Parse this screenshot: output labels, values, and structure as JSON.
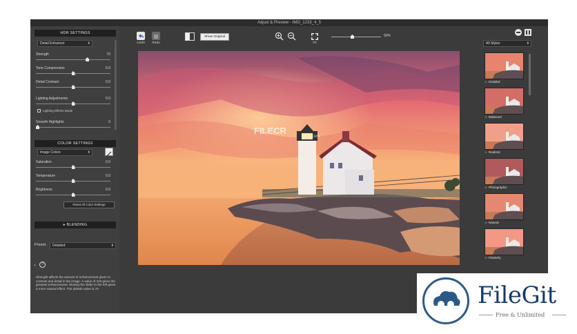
{
  "window": {
    "title": "Adjust & Preview - IMG_1233_4_5"
  },
  "hdr_settings": {
    "header": "HDR SETTINGS",
    "preset_value": "Detail Enhancer",
    "sliders": [
      {
        "label": "Strength",
        "value": "70",
        "level": 0.7
      },
      {
        "label": "Tone Compression",
        "value": "0.0",
        "level": 0.5
      },
      {
        "label": "Detail Contrast",
        "value": "0.0",
        "level": 0.5
      },
      {
        "label": "Lighting Adjustments",
        "value": "0.0",
        "level": 0.5
      }
    ],
    "checkbox_label": "Lighting Effects Mode",
    "smooth_label": "Smooth Highlights",
    "smooth_value": "0",
    "smooth_level": 0.0
  },
  "color_settings": {
    "header": "COLOR SETTINGS",
    "mode_value": "Image Colors",
    "sliders": [
      {
        "label": "Saturation",
        "value": "0.0",
        "level": 0.5
      },
      {
        "label": "Temperature",
        "value": "0.0",
        "level": 0.5
      },
      {
        "label": "Brightness",
        "value": "0.0",
        "level": 0.5
      }
    ],
    "reset_label": "Reset All Color Settings"
  },
  "blending": {
    "header": "BLENDING"
  },
  "preset": {
    "label": "Preset:",
    "value": "Detailed"
  },
  "help": {
    "text": "Strength affects the amount of enhancement given to contrast and detail in the image. A value of 100 gives the greatest enhancement. Moving the slider to the left gives a more natural effect. The default value is 70."
  },
  "toolbar": {
    "undo_label": "Undo",
    "redo_label": "Redo",
    "show_original_label": "Show Original",
    "fit_label": "Fit",
    "zoom_value": "90%",
    "zoom_level": 0.4
  },
  "styles": {
    "dropdown_value": "All Styles",
    "items": [
      {
        "name": "Detailed"
      },
      {
        "name": "Balanced"
      },
      {
        "name": "Realistic"
      },
      {
        "name": "Photographic"
      },
      {
        "name": "Natural"
      },
      {
        "name": "Painterly"
      }
    ]
  },
  "watermark": {
    "text": "FILECR",
    "sub": ".com"
  },
  "badge": {
    "name": "FileGit",
    "tagline": "Free & Unlimited"
  },
  "colors": {
    "panel": "#3b3b3b",
    "section_header": "#202020",
    "badge_blue": "#173a66"
  }
}
